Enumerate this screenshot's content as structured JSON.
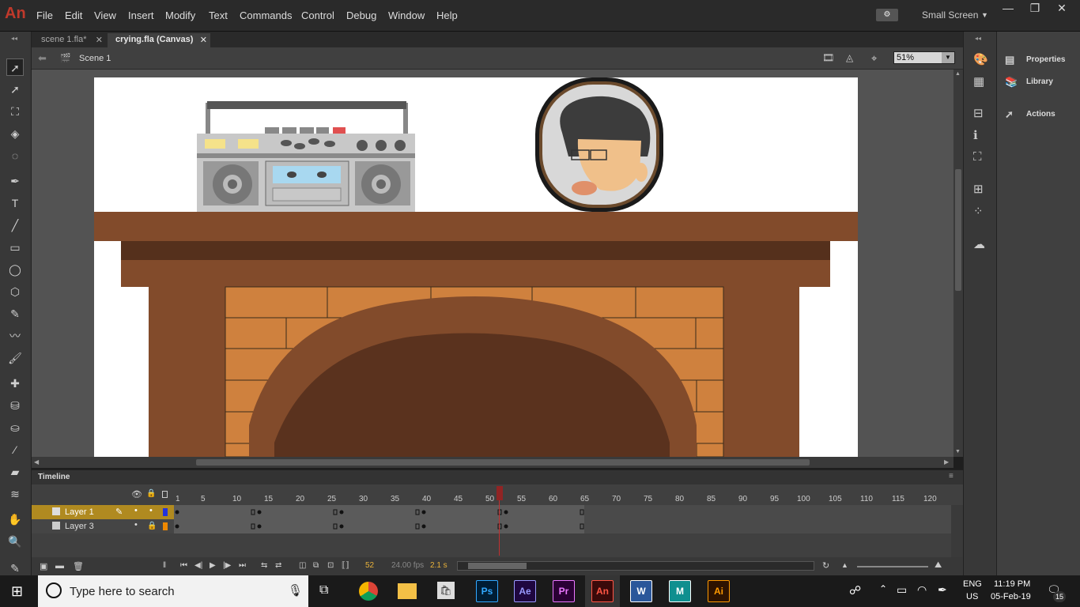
{
  "app": {
    "logo": "An"
  },
  "menu": [
    "File",
    "Edit",
    "View",
    "Insert",
    "Modify",
    "Text",
    "Commands",
    "Control",
    "Debug",
    "Window",
    "Help"
  ],
  "workspace": {
    "label": "Small Screen"
  },
  "tabs": [
    {
      "label": "scene 1.fla*"
    },
    {
      "label": "crying.fla (Canvas)"
    }
  ],
  "editbar": {
    "scene": "Scene 1",
    "zoom": "51%"
  },
  "timeline": {
    "title": "Timeline",
    "frame_numbers": [
      "1",
      "5",
      "10",
      "15",
      "20",
      "25",
      "30",
      "35",
      "40",
      "45",
      "50",
      "55",
      "60",
      "65",
      "70",
      "75",
      "80",
      "85",
      "90",
      "95",
      "100",
      "105",
      "110",
      "115",
      "120"
    ],
    "layers": [
      {
        "name": "Layer 1",
        "color": "#2233dd",
        "selected": true
      },
      {
        "name": "Layer 3",
        "color": "#ee8800",
        "selected": false
      }
    ],
    "current_frame": "52",
    "fps": "24.00 fps",
    "time": "2.1 s"
  },
  "panels": [
    {
      "label": "Properties"
    },
    {
      "label": "Library"
    },
    {
      "label": "Actions"
    }
  ],
  "taskbar": {
    "search_placeholder": "Type here to search",
    "lang_top": "ENG",
    "lang_bottom": "US",
    "time": "11:19 PM",
    "date": "05-Feb-19",
    "notif_count": "15",
    "apps": [
      {
        "label": "Ps",
        "bg": "#001d34",
        "fg": "#31a8ff"
      },
      {
        "label": "Ae",
        "bg": "#1f0740",
        "fg": "#9999ff"
      },
      {
        "label": "Pr",
        "bg": "#2a0034",
        "fg": "#ea77ff"
      },
      {
        "label": "An",
        "bg": "#3a0a0a",
        "fg": "#ff5544"
      },
      {
        "label": "W",
        "bg": "#2b579a",
        "fg": "#ffffff"
      },
      {
        "label": "M",
        "bg": "#0f8f8f",
        "fg": "#ffffff"
      },
      {
        "label": "Ai",
        "bg": "#2e1300",
        "fg": "#ff9a00"
      }
    ]
  }
}
